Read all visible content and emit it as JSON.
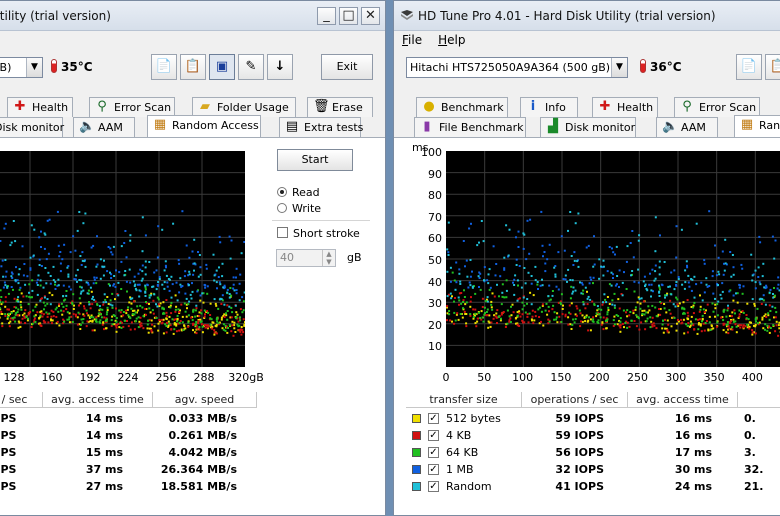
{
  "left_window": {
    "title": "Utility (trial version)",
    "drive_text": "GB)",
    "temperature": "35°C",
    "exit_label": "Exit",
    "tabs_row1": [
      "Health",
      "Error Scan",
      "Folder Usage",
      "Erase"
    ],
    "tabs_row2": [
      "Disk monitor",
      "AAM",
      "Random Access",
      "Extra tests"
    ],
    "active_tab": "Random Access",
    "start_label": "Start",
    "radio_read": "Read",
    "radio_write": "Write",
    "short_stroke_label": "Short stroke",
    "stroke_value": "40",
    "stroke_unit": "gB",
    "x_ticks": [
      "128",
      "160",
      "192",
      "224",
      "256",
      "288",
      "320gB"
    ],
    "columns": [
      " / sec",
      "avg. access time",
      "agv. speed"
    ],
    "rows": [
      {
        "ops": "IOPS",
        "access": "14 ms",
        "speed": "0.033 MB/s"
      },
      {
        "ops": "IOPS",
        "access": "14 ms",
        "speed": "0.261 MB/s"
      },
      {
        "ops": "IOPS",
        "access": "15 ms",
        "speed": "4.042 MB/s"
      },
      {
        "ops": "IOPS",
        "access": "37 ms",
        "speed": "26.364 MB/s"
      },
      {
        "ops": "IOPS",
        "access": "27 ms",
        "speed": "18.581 MB/s"
      }
    ]
  },
  "right_window": {
    "title": "HD Tune Pro 4.01 - Hard Disk Utility (trial version)",
    "menu": [
      "File",
      "Help"
    ],
    "drive_text": "Hitachi HTS725050A9A364 (500 gB)",
    "temperature": "36°C",
    "tabs_row1": [
      "Benchmark",
      "Info",
      "Health",
      "Error Scan"
    ],
    "tabs_row2": [
      "File Benchmark",
      "Disk monitor",
      "AAM",
      "Ran"
    ],
    "y_unit": "ms",
    "y_ticks": [
      "100",
      "90",
      "80",
      "70",
      "60",
      "50",
      "40",
      "30",
      "20",
      "10"
    ],
    "x_ticks": [
      "0",
      "50",
      "100",
      "150",
      "200",
      "250",
      "300",
      "350",
      "400"
    ],
    "columns": [
      "transfer size",
      "operations / sec",
      "avg. access time",
      ""
    ],
    "rows": [
      {
        "size": "512 bytes",
        "ops": "59 IOPS",
        "access": "16 ms",
        "speed": "0."
      },
      {
        "size": "4 KB",
        "ops": "59 IOPS",
        "access": "16 ms",
        "speed": "0."
      },
      {
        "size": "64 KB",
        "ops": "56 IOPS",
        "access": "17 ms",
        "speed": "3."
      },
      {
        "size": "1 MB",
        "ops": "32 IOPS",
        "access": "30 ms",
        "speed": "32."
      },
      {
        "size": "Random",
        "ops": "41 IOPS",
        "access": "24 ms",
        "speed": "21."
      }
    ],
    "series_colors": [
      "#f0e000",
      "#d01010",
      "#20c020",
      "#1060e0",
      "#20c0d8"
    ]
  }
}
